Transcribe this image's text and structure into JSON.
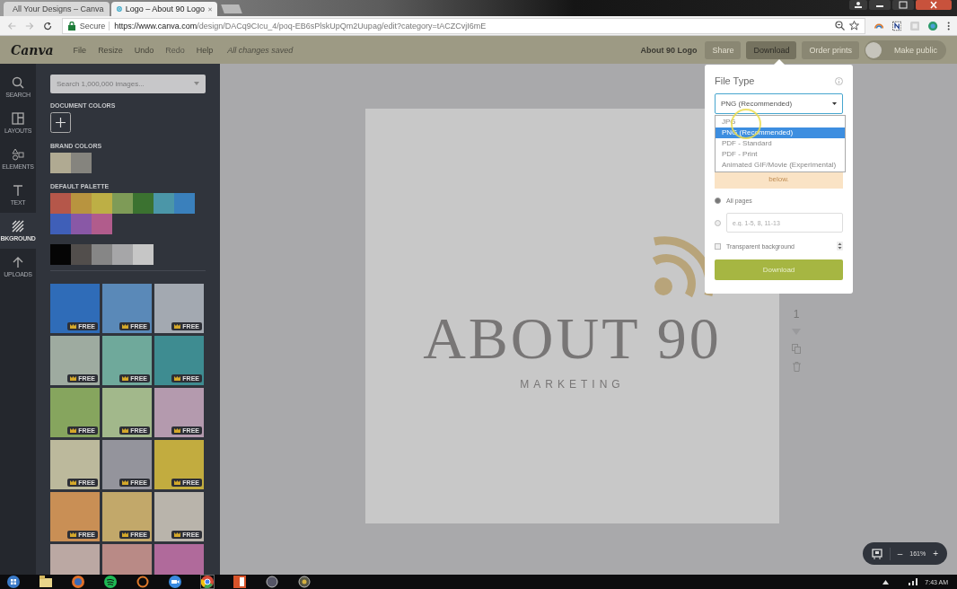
{
  "browser": {
    "tabs": [
      {
        "title": "All Your Designs – Canva",
        "selected": false
      },
      {
        "title": "Logo – About 90 Logo",
        "selected": true
      }
    ],
    "address": {
      "secure_label": "Secure",
      "url_host": "https://www.canva.com",
      "url_path": "/design/DACq9CIcu_4/poq-EB6sPlskUpQm2Uupag/edit?category=tACZCvjI6mE"
    }
  },
  "toolbar": {
    "logo": "Canva",
    "menu": [
      {
        "label": "File",
        "disabled": false
      },
      {
        "label": "Resize",
        "disabled": false
      },
      {
        "label": "Undo",
        "disabled": false
      },
      {
        "label": "Redo",
        "disabled": true
      },
      {
        "label": "Help",
        "disabled": false
      }
    ],
    "save_status": "All changes saved",
    "design_title": "About 90 Logo",
    "buttons": [
      {
        "label": "Share",
        "selected": false
      },
      {
        "label": "Download",
        "selected": true
      },
      {
        "label": "Order prints",
        "selected": false
      }
    ],
    "publish": {
      "label": "Make public",
      "on": false
    }
  },
  "nav": [
    {
      "kind": "search",
      "label": "SEARCH",
      "selected": false
    },
    {
      "kind": "layouts",
      "label": "LAYOUTS",
      "selected": false
    },
    {
      "kind": "elements",
      "label": "ELEMENTS",
      "selected": false
    },
    {
      "kind": "text",
      "label": "TEXT",
      "selected": false
    },
    {
      "kind": "background",
      "label": "BKGROUND",
      "selected": true
    },
    {
      "kind": "uploads",
      "label": "UPLOADS",
      "selected": false
    }
  ],
  "panel": {
    "search_placeholder": "Search 1,000,000 images...",
    "document_colors": {
      "label": "DOCUMENT COLORS"
    },
    "brand_colors": {
      "label": "BRAND COLORS",
      "colors": [
        {
          "color": "#b0aa92"
        },
        {
          "color": "#85847e"
        }
      ]
    },
    "default_palette": {
      "label": "DEFAULT PALETTE",
      "colors": [
        {
          "color": "#b5574a"
        },
        {
          "color": "#b8943f"
        },
        {
          "color": "#bdaf45"
        },
        {
          "color": "#7e9b57"
        },
        {
          "color": "#3b7230"
        },
        {
          "color": "#4b96a8"
        },
        {
          "color": "#3a80bc"
        },
        {
          "color": "#3f5fb8"
        },
        {
          "color": "#8958a6"
        },
        {
          "color": "#b15c8c"
        }
      ]
    },
    "grays": [
      {
        "color": "#050505"
      },
      {
        "color": "#524e4c"
      },
      {
        "color": "#868686"
      },
      {
        "color": "#a6a6a8"
      },
      {
        "color": "#c6c6c6"
      }
    ],
    "backgrounds": [
      {
        "color": "#2f6cb8",
        "badge": "FREE"
      },
      {
        "color": "#5a89b8",
        "badge": "FREE"
      },
      {
        "color": "#a3a9b1",
        "badge": "FREE"
      },
      {
        "color": "#9eaba0",
        "badge": "FREE"
      },
      {
        "color": "#6fa99b",
        "badge": "FREE"
      },
      {
        "color": "#3e8c91",
        "badge": "FREE"
      },
      {
        "color": "#86a55e",
        "badge": "FREE"
      },
      {
        "color": "#a2b88b",
        "badge": "FREE"
      },
      {
        "color": "#b49aae",
        "badge": "FREE"
      },
      {
        "color": "#bcb99c",
        "badge": "FREE"
      },
      {
        "color": "#94949c",
        "badge": "FREE"
      },
      {
        "color": "#c2ac3f",
        "badge": "FREE"
      },
      {
        "color": "#c98f55",
        "badge": "FREE"
      },
      {
        "color": "#c2a86a",
        "badge": "FREE"
      },
      {
        "color": "#b9b4ab",
        "badge": "FREE"
      },
      {
        "color": "#bba8a3"
      },
      {
        "color": "#b98a86"
      },
      {
        "color": "#b06a9b"
      }
    ]
  },
  "download_popup": {
    "title": "File Type",
    "file_type": {
      "value": "PNG (Recommended)",
      "options": [
        {
          "label": "JPG",
          "selected": false
        },
        {
          "label": "PNG (Recommended)",
          "selected": true
        },
        {
          "label": "PDF - Standard",
          "selected": false
        },
        {
          "label": "PDF - Print",
          "selected": false
        },
        {
          "label": "Animated GIF/Movie (Experimental)",
          "selected": false
        }
      ]
    },
    "notice": "below.",
    "pages": [
      {
        "kind": "all",
        "label": "All pages",
        "selected": true
      },
      {
        "kind": "range",
        "placeholder": "e.g. 1-5, 8, 11-13",
        "selected": false
      }
    ],
    "transparent": {
      "label": "Transparent background",
      "checked": false
    },
    "download": "Download"
  },
  "canvas": {
    "title": "ABOUT 90",
    "subtitle": "MARKETING",
    "page_number": "1",
    "zoom_out": "–",
    "zoom": "161%",
    "zoom_in": "+"
  },
  "taskbar": {
    "time": "7:43 AM"
  }
}
